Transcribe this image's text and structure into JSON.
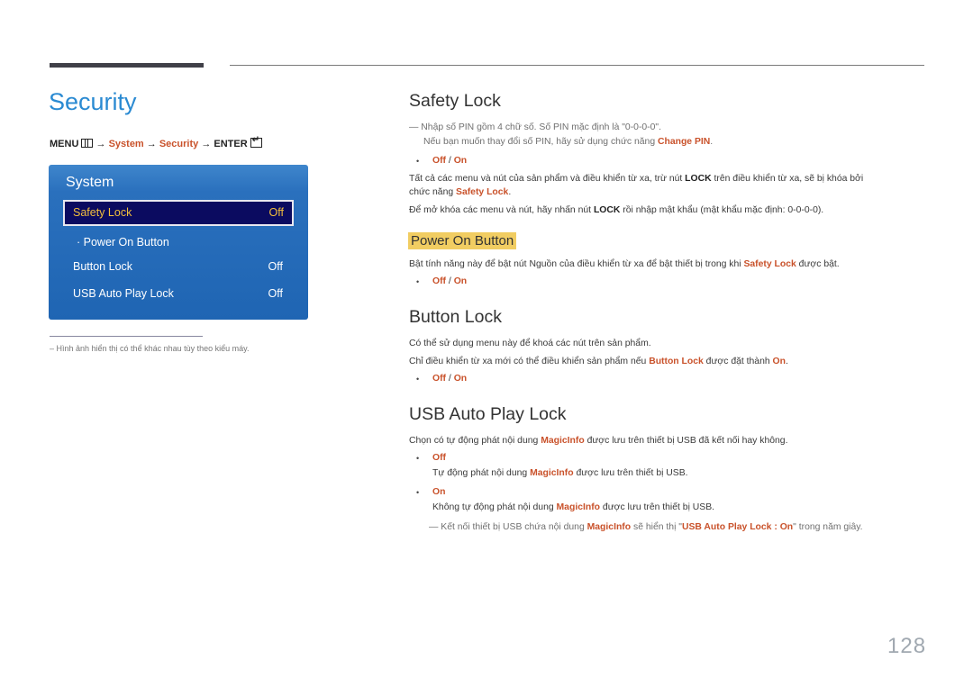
{
  "page": {
    "title": "Security",
    "number": "128"
  },
  "menu_path": {
    "menu": "MENU",
    "menu_icon": "menu-grid-icon",
    "arrow": "→",
    "system": "System",
    "security": "Security",
    "enter": "ENTER",
    "enter_icon": "enter-icon"
  },
  "osd": {
    "title": "System",
    "items": [
      {
        "label": "Safety Lock",
        "value": "Off",
        "selected": true
      },
      {
        "label": "· Power On Button",
        "value": ""
      },
      {
        "label": "Button Lock",
        "value": "Off"
      },
      {
        "label": "USB Auto Play Lock",
        "value": "Off"
      }
    ]
  },
  "footnote": "– Hình ảnh hiển thị có thể khác nhau tùy theo kiểu máy.",
  "sections": {
    "safety_lock": {
      "heading": "Safety Lock",
      "note_line1": "Nhập số PIN gồm 4 chữ số. Số PIN mặc định là \"0-0-0-0\".",
      "note_line2_pre": "Nếu bạn muốn thay đổi số PIN, hãy sử dụng chức năng ",
      "note_line2_hl": "Change PIN",
      "note_line2_post": ".",
      "options": {
        "off": "Off",
        "sep": " / ",
        "on": "On"
      },
      "para1_a": "Tất cả các menu và nút của sản phẩm và điều khiển từ xa, trừ nút ",
      "para1_b": "LOCK",
      "para1_c": " trên điều khiển từ xa, sẽ bị khóa bởi",
      "para1_d": "chức năng ",
      "para1_e": "Safety Lock",
      "para1_f": ".",
      "para2_a": "Để mở khóa các menu và nút, hãy nhấn nút ",
      "para2_b": "LOCK",
      "para2_c": " rồi nhập mật khẩu (mật khẩu mặc định: 0-0-0-0)."
    },
    "power_on_button": {
      "heading": "Power On Button",
      "para_a": "Bật tính năng này để bật nút Nguồn của điều khiển từ xa để bật thiết bị trong khi ",
      "para_b": "Safety Lock",
      "para_c": " được bật.",
      "options": {
        "off": "Off",
        "sep": " / ",
        "on": "On"
      }
    },
    "button_lock": {
      "heading": "Button Lock",
      "para1": "Có thể sử dụng menu này để khoá các nút trên sản phẩm.",
      "para2_a": "Chỉ điều khiển từ xa mới có thể điều khiển sản phẩm nếu ",
      "para2_b": "Button Lock",
      "para2_c": " được đặt thành ",
      "para2_d": "On",
      "para2_e": ".",
      "options": {
        "off": "Off",
        "sep": " / ",
        "on": "On"
      }
    },
    "usb_auto_play_lock": {
      "heading": "USB Auto Play Lock",
      "para_a": "Chọn có tự động phát nội dung ",
      "para_b": "MagicInfo",
      "para_c": " được lưu trên thiết bị USB đã kết nối hay không.",
      "off_label": "Off",
      "off_desc_a": "Tự động phát nội dung ",
      "off_desc_b": "MagicInfo",
      "off_desc_c": " được lưu trên thiết bị USB.",
      "on_label": "On",
      "on_desc_a": "Không tự động phát nội dung ",
      "on_desc_b": "MagicInfo",
      "on_desc_c": " được lưu trên thiết bị USB.",
      "note_a": "Kết nối thiết bị USB chứa nội dung ",
      "note_b": "MagicInfo",
      "note_c": " sẽ hiển thị \"",
      "note_d": "USB Auto Play Lock : On",
      "note_e": "\" trong năm giây."
    }
  }
}
